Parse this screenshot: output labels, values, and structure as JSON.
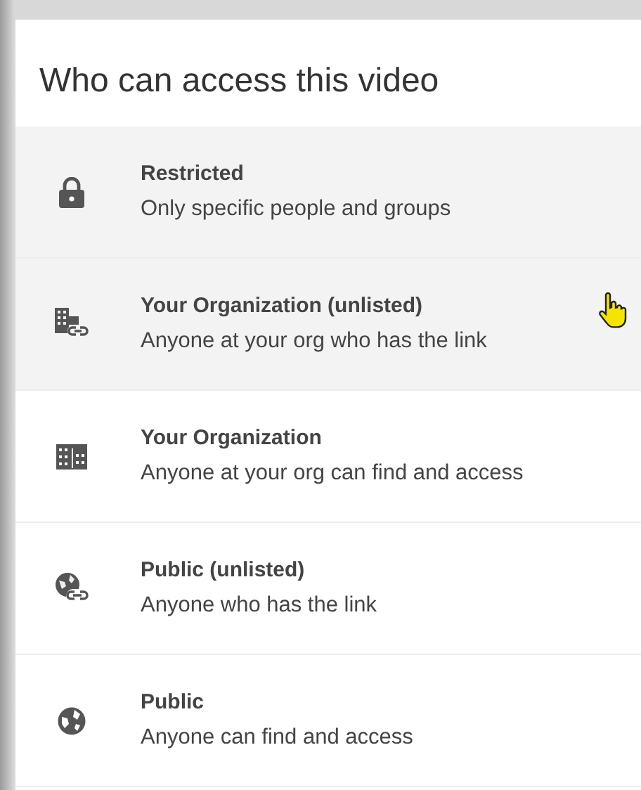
{
  "title": "Who can access this video",
  "options": [
    {
      "kind": "restricted",
      "label": "Restricted",
      "description": "Only specific people and groups",
      "highlighted": true,
      "hovered": false
    },
    {
      "kind": "org-unlisted",
      "label": "Your Organization (unlisted)",
      "description": "Anyone at your org who has the link",
      "highlighted": true,
      "hovered": true
    },
    {
      "kind": "org",
      "label": "Your Organization",
      "description": "Anyone at your org can find and access",
      "highlighted": false,
      "hovered": false
    },
    {
      "kind": "public-unlisted",
      "label": "Public (unlisted)",
      "description": "Anyone who has the link",
      "highlighted": false,
      "hovered": false
    },
    {
      "kind": "public",
      "label": "Public",
      "description": "Anyone can find and access",
      "highlighted": false,
      "hovered": false
    }
  ]
}
